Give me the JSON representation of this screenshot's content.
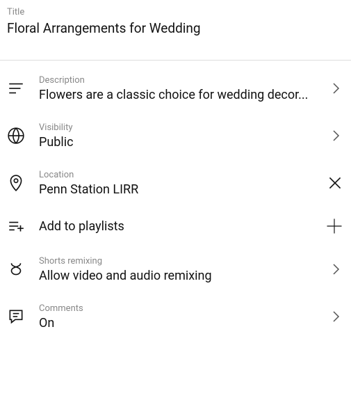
{
  "title": {
    "label": "Title",
    "value": "Floral Arrangements for Wedding"
  },
  "rows": {
    "description": {
      "label": "Description",
      "value": "Flowers are a classic choice for wedding decor..."
    },
    "visibility": {
      "label": "Visibility",
      "value": "Public"
    },
    "location": {
      "label": "Location",
      "value": "Penn Station LIRR"
    },
    "playlists": {
      "label": "Add to playlists"
    },
    "remixing": {
      "label": "Shorts remixing",
      "value": "Allow video and audio remixing"
    },
    "comments": {
      "label": "Comments",
      "value": "On"
    }
  }
}
